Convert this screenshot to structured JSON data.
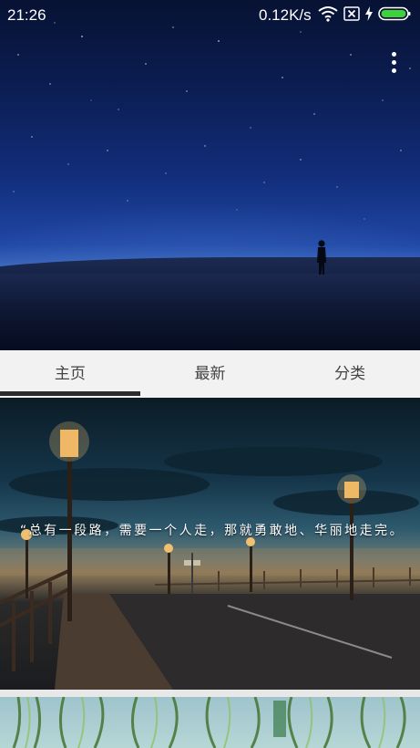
{
  "status_bar": {
    "time": "21:26",
    "network_speed": "0.12K/s",
    "icons": [
      "wifi-icon",
      "sim-disabled-icon",
      "charging-icon",
      "battery-icon"
    ],
    "battery_color": "#3fd13a"
  },
  "toolbar": {
    "more_icon": "more-vert-icon"
  },
  "tabs": [
    {
      "label": "主页",
      "selected": true
    },
    {
      "label": "最新",
      "selected": false
    },
    {
      "label": "分类",
      "selected": false
    }
  ],
  "feed": {
    "items": [
      {
        "quote": "“总有一段路，需要一个人走，那就勇敢地、华丽地走完。"
      }
    ]
  },
  "colors": {
    "tab_bar_bg": "#f2f2f2",
    "tab_indicator": "#2b2b2b",
    "tab_text": "#444444"
  }
}
